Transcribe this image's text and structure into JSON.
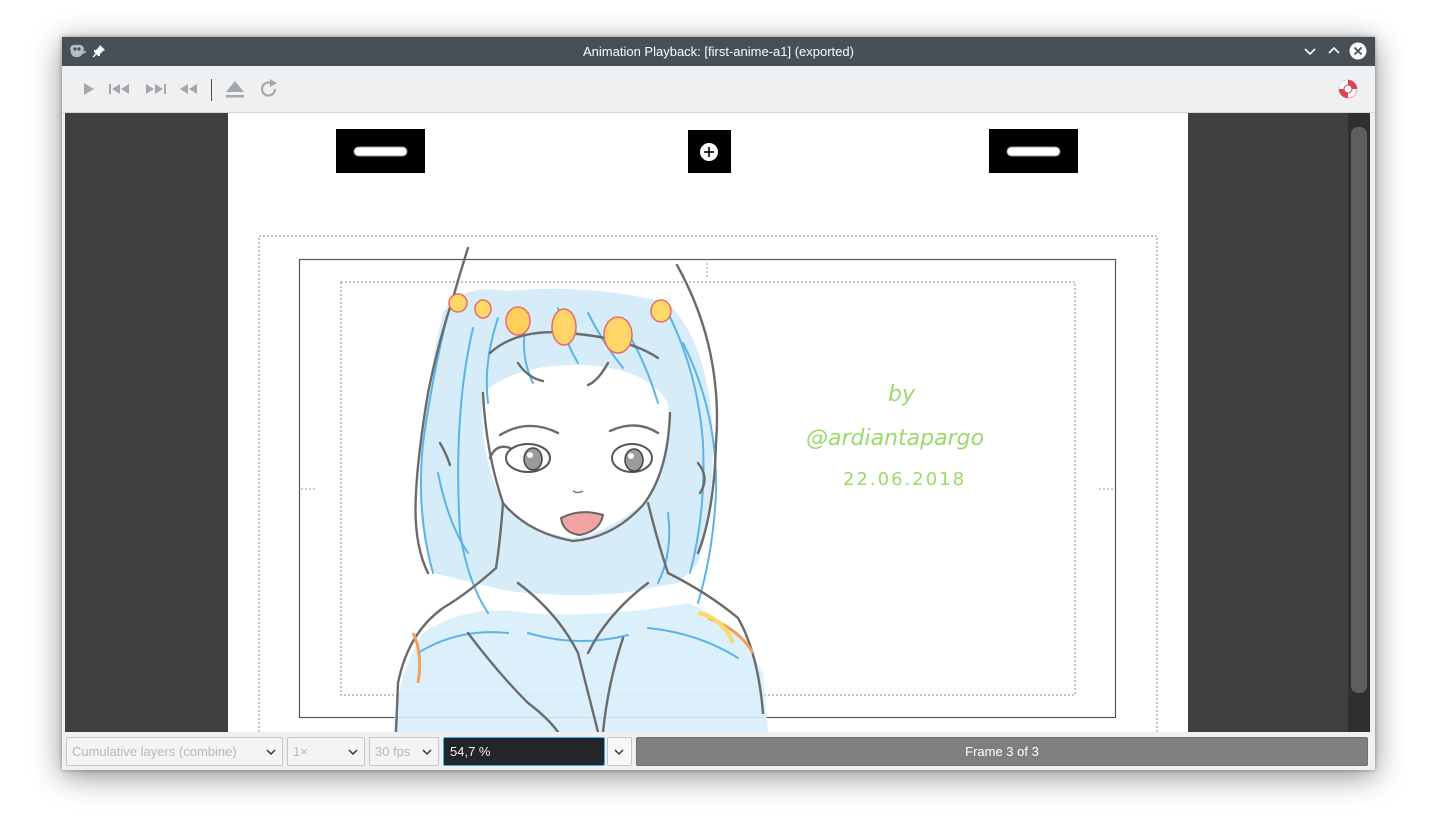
{
  "window": {
    "title": "Animation Playback: [first-anime-a1] (exported)"
  },
  "titlebar": {
    "left_icons": [
      "gimp-app-icon",
      "pin-icon"
    ],
    "right_icons": [
      "minimize-chevron-icon",
      "maximize-chevron-icon",
      "close-icon"
    ]
  },
  "toolbar": {
    "icons": [
      "play-icon",
      "skip-to-start-icon",
      "skip-to-end-icon",
      "rewind-icon",
      "detach-icon",
      "reload-icon",
      "help-lifebuoy-icon"
    ]
  },
  "canvas": {
    "signature": {
      "line1": "by",
      "line2": "@ardiantapargo",
      "line3": "22.06.2018"
    }
  },
  "statusbar": {
    "layer_mode": "Cumulative layers (combine)",
    "speed": "1×",
    "fps": "30 fps",
    "zoom": "54,7 %",
    "frame_label": "Frame 3 of 3"
  },
  "colors": {
    "titlebar": "#475057",
    "viewport": "#404040",
    "zoom_entry_bg": "#232629",
    "focus_border": "#3daee9",
    "progress_bg": "#7f7f7f",
    "sketch_blue": "#5ab4e8",
    "sketch_gray": "#6b6b6b",
    "signature_green": "#9ad96a"
  }
}
